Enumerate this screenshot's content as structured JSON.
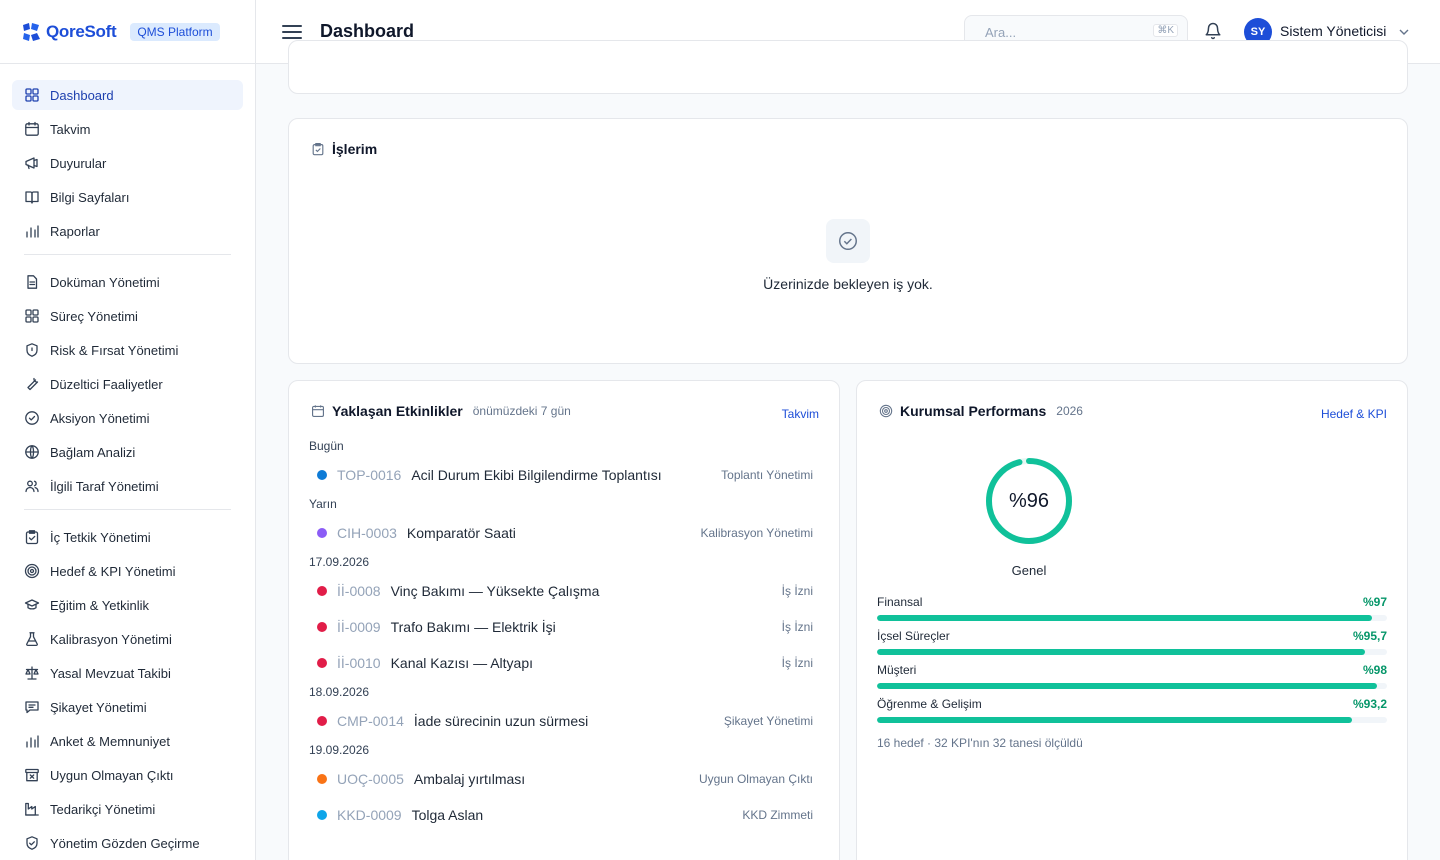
{
  "brand": {
    "name": "QoreSoft",
    "badge": "QMS Platform"
  },
  "header": {
    "title": "Dashboard",
    "search_placeholder": "Ara...",
    "search_shortcut": "⌘K",
    "user_initials": "SY",
    "user_name": "Sistem Yöneticisi"
  },
  "sidebar": {
    "group1": [
      {
        "label": "Dashboard",
        "icon": "grid-icon",
        "active": true
      },
      {
        "label": "Takvim",
        "icon": "calendar-icon"
      },
      {
        "label": "Duyurular",
        "icon": "megaphone-icon"
      },
      {
        "label": "Bilgi Sayfaları",
        "icon": "book-icon"
      },
      {
        "label": "Raporlar",
        "icon": "bar-chart-icon"
      }
    ],
    "group2": [
      {
        "label": "Doküman Yönetimi",
        "icon": "document-icon"
      },
      {
        "label": "Süreç Yönetimi",
        "icon": "grid-icon"
      },
      {
        "label": "Risk & Fırsat Yönetimi",
        "icon": "shield-icon"
      },
      {
        "label": "Düzeltici Faaliyetler",
        "icon": "wrench-icon"
      },
      {
        "label": "Aksiyon Yönetimi",
        "icon": "check-circle-icon"
      },
      {
        "label": "Bağlam Analizi",
        "icon": "globe-icon"
      },
      {
        "label": "İlgili Taraf Yönetimi",
        "icon": "users-icon"
      }
    ],
    "group3": [
      {
        "label": "İç Tetkik Yönetimi",
        "icon": "clipboard-icon"
      },
      {
        "label": "Hedef & KPI Yönetimi",
        "icon": "target-icon"
      },
      {
        "label": "Eğitim & Yetkinlik",
        "icon": "graduation-cap-icon"
      },
      {
        "label": "Kalibrasyon Yönetimi",
        "icon": "flask-icon"
      },
      {
        "label": "Yasal Mevzuat Takibi",
        "icon": "scale-icon"
      },
      {
        "label": "Şikayet Yönetimi",
        "icon": "message-icon"
      },
      {
        "label": "Anket & Memnuniyet",
        "icon": "bar-chart-icon"
      },
      {
        "label": "Uygun Olmayan Çıktı",
        "icon": "archive-x-icon"
      },
      {
        "label": "Tedarikçi Yönetimi",
        "icon": "factory-icon"
      },
      {
        "label": "Yönetim Gözden Geçirme",
        "icon": "shield-check-icon"
      }
    ]
  },
  "isler": {
    "title": "İşlerim",
    "empty_text": "Üzerinizde bekleyen iş yok."
  },
  "events": {
    "title": "Yaklaşan Etkinlikler",
    "subtitle": "önümüzdeki 7 gün",
    "link": "Takvim",
    "groups": [
      {
        "date": "Bugün",
        "items": [
          {
            "code": "TOP-0016",
            "title": "Acil Durum Ekibi Bilgilendirme Toplantısı",
            "category": "Toplantı Yönetimi",
            "color": "#0e7bd6"
          }
        ]
      },
      {
        "date": "Yarın",
        "items": [
          {
            "code": "CIH-0003",
            "title": "Komparatör Saati",
            "category": "Kalibrasyon Yönetimi",
            "color": "#8b5cf6"
          }
        ]
      },
      {
        "date": "17.09.2026",
        "items": [
          {
            "code": "İİ-0008",
            "title": "Vinç Bakımı — Yüksekte Çalışma",
            "category": "İş İzni",
            "color": "#e11d48"
          },
          {
            "code": "İİ-0009",
            "title": "Trafo Bakımı — Elektrik İşi",
            "category": "İş İzni",
            "color": "#e11d48"
          },
          {
            "code": "İİ-0010",
            "title": "Kanal Kazısı — Altyapı",
            "category": "İş İzni",
            "color": "#e11d48"
          }
        ]
      },
      {
        "date": "18.09.2026",
        "items": [
          {
            "code": "CMP-0014",
            "title": "İade sürecinin uzun sürmesi",
            "category": "Şikayet Yönetimi",
            "color": "#e11d48"
          }
        ]
      },
      {
        "date": "19.09.2026",
        "items": [
          {
            "code": "UOÇ-0005",
            "title": "Ambalaj yırtılması",
            "category": "Uygun Olmayan Çıktı",
            "color": "#f97316"
          },
          {
            "code": "KKD-0009",
            "title": "Tolga Aslan",
            "category": "KKD Zimmeti",
            "color": "#0ea5e9"
          }
        ]
      }
    ]
  },
  "performance": {
    "title": "Kurumsal Performans",
    "year": "2026",
    "link": "Hedef & KPI",
    "overall_label": "%96",
    "overall_value": 96,
    "overall_caption": "Genel",
    "kpis": [
      {
        "name": "Finansal",
        "label": "%97",
        "value": 97
      },
      {
        "name": "İçsel Süreçler",
        "label": "%95,7",
        "value": 95.7
      },
      {
        "name": "Müşteri",
        "label": "%98",
        "value": 98
      },
      {
        "name": "Öğrenme & Gelişim",
        "label": "%93,2",
        "value": 93.2
      }
    ],
    "footer": "16 hedef · 32 KPI'nın 32 tanesi ölçüldü"
  },
  "colors": {
    "accent": "#1d4ed8",
    "success": "#10c19a",
    "success_text": "#059669"
  }
}
